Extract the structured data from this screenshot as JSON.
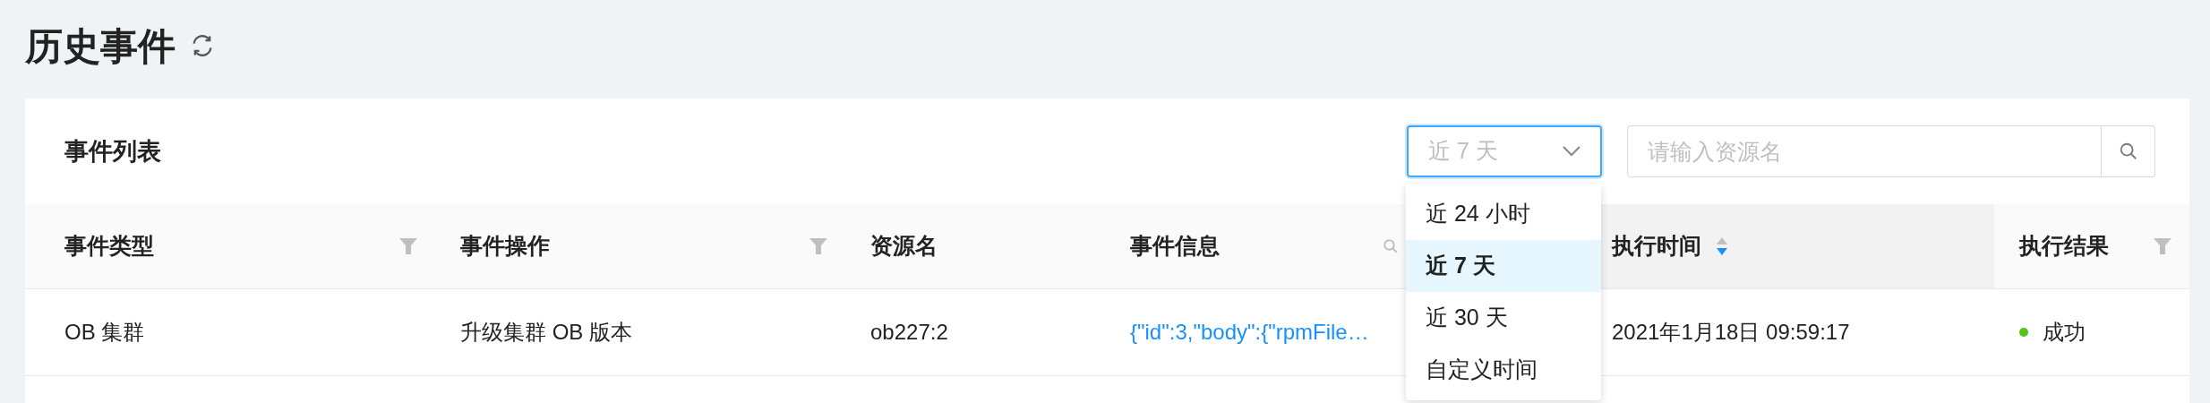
{
  "page_title": "历史事件",
  "card": {
    "title": "事件列表",
    "range_select": {
      "value": "近 7 天",
      "open": true,
      "options": [
        {
          "label": "近 24 小时",
          "selected": false
        },
        {
          "label": "近 7 天",
          "selected": true
        },
        {
          "label": "近 30 天",
          "selected": false
        },
        {
          "label": "自定义时间",
          "selected": false
        }
      ]
    },
    "search": {
      "placeholder": "请输入资源名"
    },
    "table": {
      "columns": [
        {
          "label": "事件类型",
          "filter": true
        },
        {
          "label": "事件操作",
          "filter": true
        },
        {
          "label": "资源名"
        },
        {
          "label": "事件信息",
          "search": true
        },
        {
          "label": "执行时间",
          "sort_descending": true
        },
        {
          "label": "执行结果",
          "filter": true
        }
      ],
      "rows": [
        {
          "cells": [
            "OB 集群",
            "升级集群 OB 版本",
            "ob227:2",
            "{\"id\":3,\"body\":{\"rpmFile…",
            "2021年1月18日 09:59:17"
          ],
          "status": {
            "label": "成功",
            "color": "#52c41a"
          }
        }
      ]
    }
  }
}
